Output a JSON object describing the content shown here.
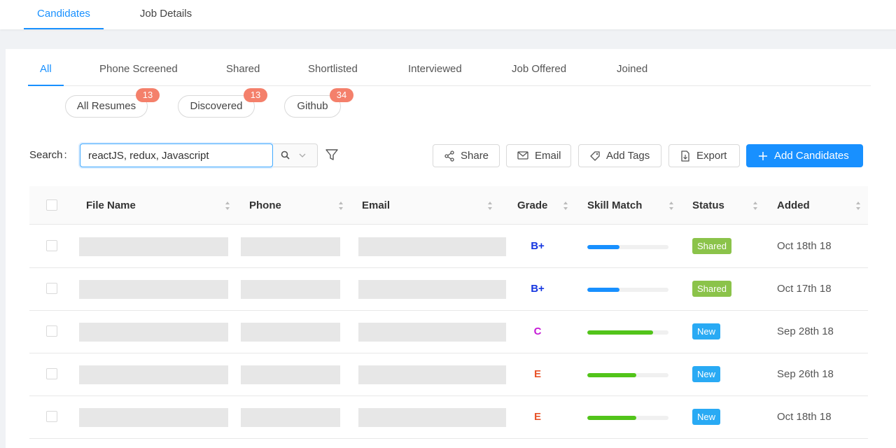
{
  "top_tabs": [
    {
      "label": "Candidates",
      "active": true
    },
    {
      "label": "Job Details",
      "active": false
    }
  ],
  "sub_tabs": [
    "All",
    "Phone Screened",
    "Shared",
    "Shortlisted",
    "Interviewed",
    "Job Offered",
    "Joined"
  ],
  "sources": [
    {
      "label": "All Resumes",
      "count": "13"
    },
    {
      "label": "Discovered",
      "count": "13"
    },
    {
      "label": "Github",
      "count": "34"
    }
  ],
  "search": {
    "label": "Search",
    "colon": ":",
    "value": "reactJS, redux, Javascript"
  },
  "actions": {
    "share": "Share",
    "email": "Email",
    "add_tags": "Add Tags",
    "export": "Export",
    "add_candidates": "Add Candidates"
  },
  "columns": [
    "File Name",
    "Phone",
    "Email",
    "Grade",
    "Skill Match",
    "Status",
    "Added"
  ],
  "rows": [
    {
      "grade": "B+",
      "grade_color": "#1536e0",
      "skill_match": 0.4,
      "bar_color": "#1890ff",
      "status": "Shared",
      "status_color": "#8bc34a",
      "added": "Oct 18th 18"
    },
    {
      "grade": "B+",
      "grade_color": "#1536e0",
      "skill_match": 0.4,
      "bar_color": "#1890ff",
      "status": "Shared",
      "status_color": "#8bc34a",
      "added": "Oct 17th 18"
    },
    {
      "grade": "C",
      "grade_color": "#c51ad6",
      "skill_match": 0.81,
      "bar_color": "#52c41a",
      "status": "New",
      "status_color": "#29aaf4",
      "added": "Sep 28th 18"
    },
    {
      "grade": "E",
      "grade_color": "#e8542a",
      "skill_match": 0.6,
      "bar_color": "#52c41a",
      "status": "New",
      "status_color": "#29aaf4",
      "added": "Sep 26th 18"
    },
    {
      "grade": "E",
      "grade_color": "#e8542a",
      "skill_match": 0.6,
      "bar_color": "#52c41a",
      "status": "New",
      "status_color": "#29aaf4",
      "added": "Oct 18th 18"
    }
  ]
}
